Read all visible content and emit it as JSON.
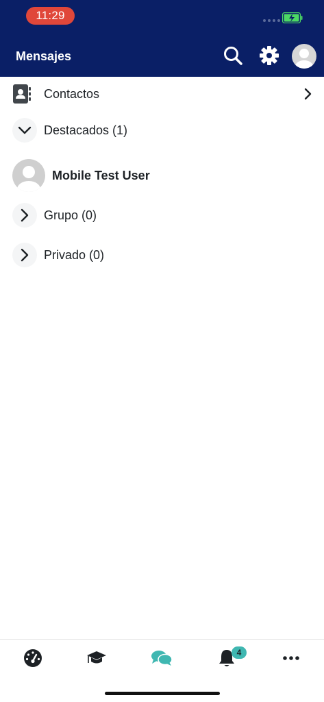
{
  "status_bar": {
    "time": "11:29"
  },
  "header": {
    "title": "Mensajes"
  },
  "contacts": {
    "label": "Contactos"
  },
  "starred": {
    "label": "Destacados (1)",
    "users": [
      {
        "name": "Mobile Test User"
      }
    ]
  },
  "group": {
    "label": "Grupo (0)"
  },
  "private": {
    "label": "Privado (0)"
  },
  "bottom_nav": {
    "items": [
      {
        "icon": "dashboard-icon"
      },
      {
        "icon": "graduation-cap-icon"
      },
      {
        "icon": "messages-icon",
        "active": true
      },
      {
        "icon": "bell-icon"
      },
      {
        "icon": "more-icon"
      }
    ],
    "notifications_badge": "4"
  },
  "colors": {
    "header_bg": "#0a1f66",
    "time_pill": "#e0473a",
    "active_nav": "#3fb7b1",
    "battery": "#4cd964"
  }
}
